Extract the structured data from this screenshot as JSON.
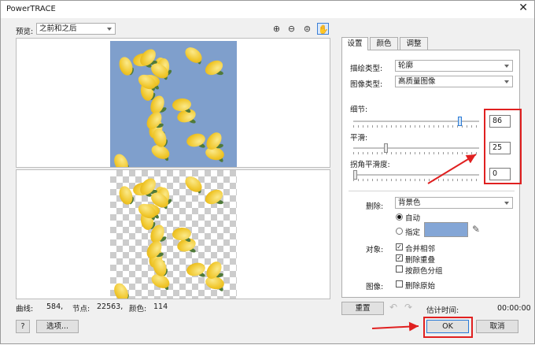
{
  "window": {
    "title": "PowerTRACE",
    "close_glyph": "✕"
  },
  "preview": {
    "label": "预览:",
    "value": "之前和之后"
  },
  "zoom_tools": [
    {
      "name": "zoom-in-icon",
      "glyph": "⊕"
    },
    {
      "name": "zoom-out-icon",
      "glyph": "⊖"
    },
    {
      "name": "zoom-fit-icon",
      "glyph": "⊜"
    },
    {
      "name": "pan-hand-icon",
      "glyph": "✋"
    }
  ],
  "stats": {
    "curves_label": "曲线:",
    "curves": "584,",
    "nodes_label": "节点:",
    "nodes": "22563,",
    "colors_label": "颜色:",
    "colors": "114"
  },
  "tabs": [
    {
      "label": "设置"
    },
    {
      "label": "颜色"
    },
    {
      "label": "调整"
    }
  ],
  "settings": {
    "trace_type_label": "描绘类型:",
    "trace_type": "轮廓",
    "image_type_label": "图像类型:",
    "image_type": "高质量图像",
    "detail_label": "细节:",
    "detail": "86",
    "detail_level": 0.86,
    "smoothing_label": "平滑:",
    "smoothing": "25",
    "smoothing_level": 0.25,
    "corner_label": "拐角平滑度:",
    "corner": "0",
    "corner_level": 0.0,
    "remove_label": "删除:",
    "remove_value": "背景色",
    "auto_label": "自动",
    "specify_label": "指定",
    "specify_color": "#84a6d6",
    "objects_label": "对象:",
    "merge_label": "合并相邻",
    "merge_checked": true,
    "remove_overlap_label": "删除重叠",
    "remove_overlap_checked": true,
    "group_label": "按颜色分组",
    "group_checked": false,
    "image_label": "图像:",
    "delete_original_label": "删除原始",
    "delete_original_checked": false
  },
  "footer": {
    "reset": "重置",
    "estimate_label": "估计时间:",
    "estimate": "00:00:00",
    "help": "?",
    "options": "选项...",
    "ok": "OK",
    "cancel": "取消"
  },
  "colors": {
    "annotation_red": "#e02020",
    "accent_blue": "#2a7ad6"
  }
}
